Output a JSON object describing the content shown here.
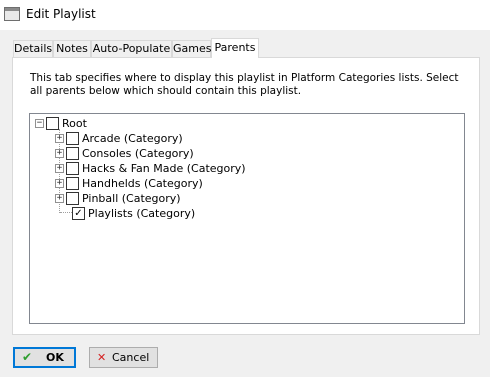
{
  "window": {
    "title": "Edit Playlist"
  },
  "tabs": [
    {
      "label": "Details"
    },
    {
      "label": "Notes"
    },
    {
      "label": "Auto-Populate"
    },
    {
      "label": "Games"
    },
    {
      "label": "Parents",
      "active": true
    }
  ],
  "parents": {
    "description": "This tab specifies where to display this playlist in Platform Categories lists. Select all parents below which should contain this playlist.",
    "tree": {
      "root": {
        "label": "Root",
        "expander": "−",
        "checked": false
      },
      "children": [
        {
          "label": "Arcade (Category)",
          "expander": "+",
          "checked": false
        },
        {
          "label": "Consoles (Category)",
          "expander": "+",
          "checked": false
        },
        {
          "label": "Hacks & Fan Made (Category)",
          "expander": "+",
          "checked": false
        },
        {
          "label": "Handhelds (Category)",
          "expander": "+",
          "checked": false
        },
        {
          "label": "Pinball (Category)",
          "expander": "+",
          "checked": false
        },
        {
          "label": "Playlists (Category)",
          "expander": "",
          "checked": true
        }
      ]
    }
  },
  "buttons": {
    "ok": {
      "label": "OK",
      "icon": "checkmark-icon",
      "icon_glyph": "✔",
      "icon_color": "#2e9e2e"
    },
    "cancel": {
      "label": "Cancel",
      "icon": "close-icon",
      "icon_glyph": "✕",
      "icon_color": "#d42020"
    }
  },
  "colors": {
    "accent": "#0078d7",
    "window_bg": "#f0f0f0",
    "tree_border": "#828790"
  }
}
